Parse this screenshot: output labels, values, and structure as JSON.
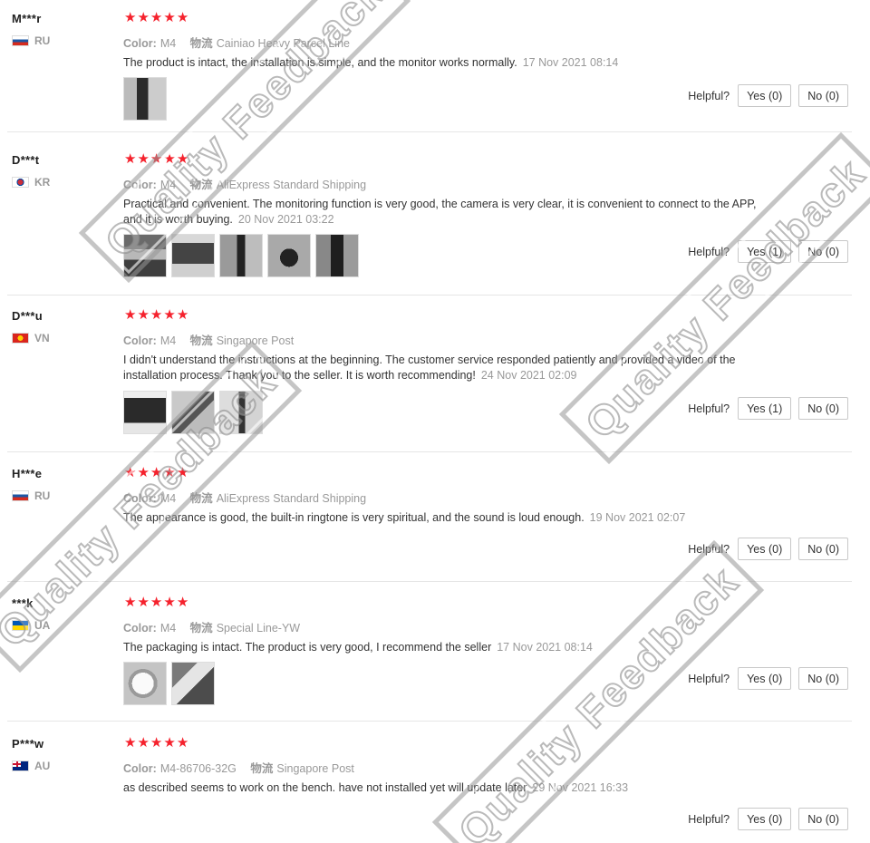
{
  "watermark_text": "Quality Feedback",
  "helpful_label": "Helpful?",
  "labels": {
    "color": "Color:",
    "shipping": "物流"
  },
  "reviews": [
    {
      "user": "M***r",
      "country": "RU",
      "flag": "ru",
      "stars": 5,
      "color": "M4",
      "shipping": "Cainiao Heavy Parcel Line",
      "text": "The product is intact, the installation is simple, and the monitor works normally.",
      "date": "17 Nov 2021 08:14",
      "photos": [
        "door-camera-photo"
      ],
      "yes": "Yes (0)",
      "no": "No (0)"
    },
    {
      "user": "D***t",
      "country": "KR",
      "flag": "kr",
      "stars": 5,
      "color": "M4",
      "shipping": "AliExpress Standard Shipping",
      "text": "Practical and convenient. The monitoring function is very good, the camera is very clear, it is convenient to connect to the APP, and it is worth buying.",
      "date": "20 Nov 2021 03:22",
      "photos": [
        "photo-1",
        "photo-2",
        "photo-3",
        "photo-4",
        "photo-5"
      ],
      "yes": "Yes (1)",
      "no": "No (0)"
    },
    {
      "user": "D***u",
      "country": "VN",
      "flag": "vn",
      "stars": 5,
      "color": "M4",
      "shipping": "Singapore Post",
      "text": "I didn't understand the instructions at the beginning. The customer service responded patiently and provided a video of the installation process. Thank you to the seller. It is worth recommending!",
      "date": "24 Nov 2021 02:09",
      "photos": [
        "photo-1",
        "photo-2",
        "photo-3"
      ],
      "yes": "Yes (1)",
      "no": "No (0)"
    },
    {
      "user": "H***e",
      "country": "RU",
      "flag": "ru",
      "stars": 5,
      "color": "M4",
      "shipping": "AliExpress Standard Shipping",
      "text": "The appearance is good, the built-in ringtone is very spiritual, and the sound is loud enough.",
      "date": "19 Nov 2021 02:07",
      "photos": [],
      "yes": "Yes (0)",
      "no": "No (0)"
    },
    {
      "user": "***k",
      "country": "UA",
      "flag": "ua",
      "stars": 5,
      "color": "M4",
      "shipping": "Special Line-YW",
      "text": "The packaging is intact. The product is very good, I recommend the seller",
      "date": "17 Nov 2021 08:14",
      "photos": [
        "photo-1",
        "photo-2"
      ],
      "yes": "Yes (0)",
      "no": "No (0)"
    },
    {
      "user": "P***w",
      "country": "AU",
      "flag": "au",
      "stars": 5,
      "color": "M4-86706-32G",
      "shipping": "Singapore Post",
      "text": "as described seems to work on the bench. have not installed yet will update later",
      "date": "29 Nov 2021 16:33",
      "photos": [],
      "yes": "Yes (0)",
      "no": "No (0)"
    }
  ]
}
